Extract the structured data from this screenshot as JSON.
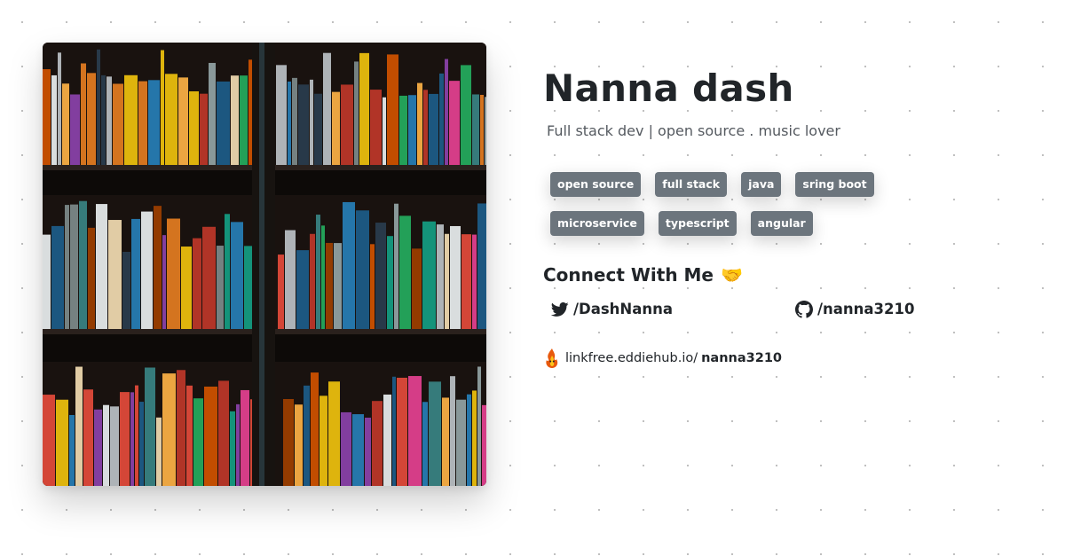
{
  "profile": {
    "name": "Nanna dash",
    "bio": "Full stack dev | open source . music lover",
    "image_subject": "bookshelf-photo"
  },
  "tags": [
    "open source",
    "full stack",
    "java",
    "sring boot",
    "microservice",
    "typescript",
    "angular"
  ],
  "connect": {
    "title": "Connect With Me",
    "emoji": "🤝",
    "twitter": {
      "icon": "twitter-icon",
      "label": "/DashNanna"
    },
    "github": {
      "icon": "github-icon",
      "label": "/nanna3210"
    }
  },
  "linkfree": {
    "icon": "linkfree-logo",
    "prefix": "linkfree.eddiehub.io/",
    "username": "nanna3210"
  },
  "colors": {
    "tag_background": "#6c757d",
    "heading_text": "#212529",
    "bio_text": "#555a60"
  }
}
